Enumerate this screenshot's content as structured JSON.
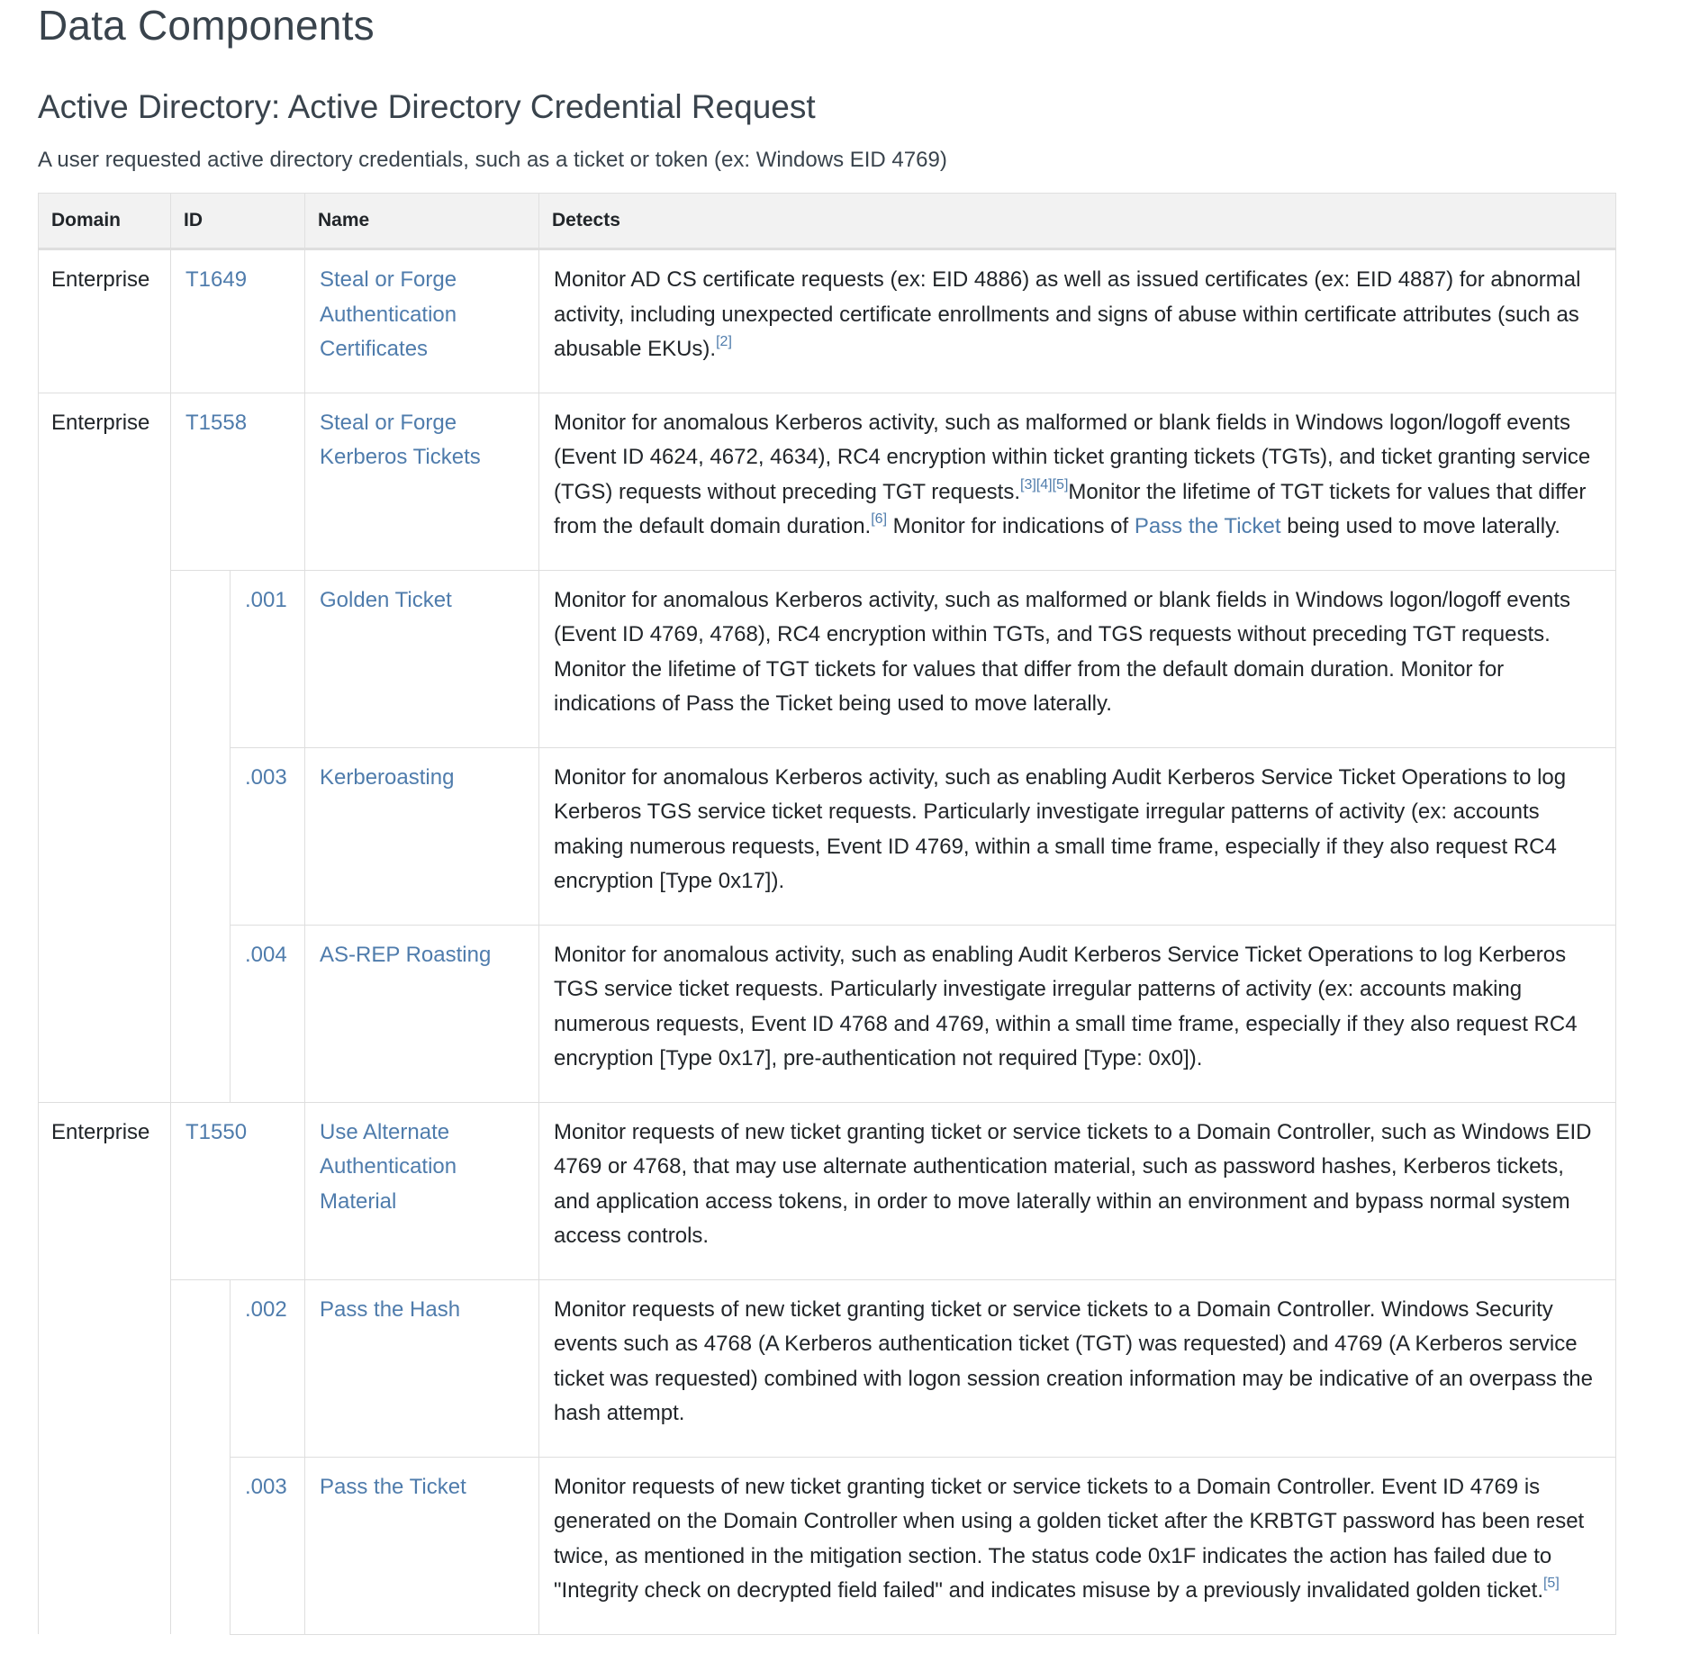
{
  "page": {
    "title": "Data Components",
    "section_title": "Active Directory: Active Directory Credential Request",
    "description": "A user requested active directory credentials, such as a ticket or token (ex: Windows EID 4769)"
  },
  "table": {
    "headers": {
      "domain": "Domain",
      "id": "ID",
      "name": "Name",
      "detects": "Detects"
    },
    "rows": [
      {
        "type": "technique",
        "domain": "Enterprise",
        "id": "T1649",
        "name": "Steal or Forge Authentication Certificates",
        "detects": [
          {
            "text": "Monitor AD CS certificate requests (ex: EID 4886) as well as issued certificates (ex: EID 4887) for abnormal activity, including unexpected certificate enrollments and signs of abuse within certificate attributes (such as abusable EKUs)."
          },
          {
            "ref": "[2]"
          }
        ]
      },
      {
        "type": "technique",
        "domain": "Enterprise",
        "id": "T1558",
        "name": "Steal or Forge Kerberos Tickets",
        "detects": [
          {
            "text": "Monitor for anomalous Kerberos activity, such as malformed or blank fields in Windows logon/logoff events (Event ID 4624, 4672, 4634), RC4 encryption within ticket granting tickets (TGTs), and ticket granting service (TGS) requests without preceding TGT requests."
          },
          {
            "ref": "[3]"
          },
          {
            "ref": "[4]"
          },
          {
            "ref": "[5]"
          },
          {
            "text": "Monitor the lifetime of TGT tickets for values that differ from the default domain duration."
          },
          {
            "ref": "[6]"
          },
          {
            "text": " Monitor for indications of "
          },
          {
            "link": "Pass the Ticket"
          },
          {
            "text": " being used to move laterally."
          }
        ]
      },
      {
        "type": "sub",
        "sub_id": ".001",
        "name": "Golden Ticket",
        "detects": [
          {
            "text": "Monitor for anomalous Kerberos activity, such as malformed or blank fields in Windows logon/logoff events (Event ID 4769, 4768), RC4 encryption within TGTs, and TGS requests without preceding TGT requests. Monitor the lifetime of TGT tickets for values that differ from the default domain duration. Monitor for indications of Pass the Ticket being used to move laterally."
          }
        ]
      },
      {
        "type": "sub",
        "sub_id": ".003",
        "name": "Kerberoasting",
        "detects": [
          {
            "text": "Monitor for anomalous Kerberos activity, such as enabling Audit Kerberos Service Ticket Operations to log Kerberos TGS service ticket requests. Particularly investigate irregular patterns of activity (ex: accounts making numerous requests, Event ID 4769, within a small time frame, especially if they also request RC4 encryption [Type 0x17])."
          }
        ]
      },
      {
        "type": "sub",
        "sub_id": ".004",
        "name": "AS-REP Roasting",
        "detects": [
          {
            "text": "Monitor for anomalous activity, such as enabling Audit Kerberos Service Ticket Operations to log Kerberos TGS service ticket requests. Particularly investigate irregular patterns of activity (ex: accounts making numerous requests, Event ID 4768 and 4769, within a small time frame, especially if they also request RC4 encryption [Type 0x17], pre-authentication not required [Type: 0x0])."
          }
        ]
      },
      {
        "type": "technique",
        "domain": "Enterprise",
        "id": "T1550",
        "name": "Use Alternate Authentication Material",
        "detects": [
          {
            "text": "Monitor requests of new ticket granting ticket or service tickets to a Domain Controller, such as Windows EID 4769 or 4768, that may use alternate authentication material, such as password hashes, Kerberos tickets, and application access tokens, in order to move laterally within an environment and bypass normal system access controls."
          }
        ]
      },
      {
        "type": "sub",
        "sub_id": ".002",
        "name": "Pass the Hash",
        "detects": [
          {
            "text": "Monitor requests of new ticket granting ticket or service tickets to a Domain Controller. Windows Security events such as 4768 (A Kerberos authentication ticket (TGT) was requested) and 4769 (A Kerberos service ticket was requested) combined with logon session creation information may be indicative of an overpass the hash attempt."
          }
        ]
      },
      {
        "type": "sub",
        "sub_id": ".003",
        "name": "Pass the Ticket",
        "detects": [
          {
            "text": "Monitor requests of new ticket granting ticket or service tickets to a Domain Controller. Event ID 4769 is generated on the Domain Controller when using a golden ticket after the KRBTGT password has been reset twice, as mentioned in the mitigation section. The status code 0x1F indicates the action has failed due to \"Integrity check on decrypted field failed\" and indicates misuse by a previously invalidated golden ticket."
          },
          {
            "ref": "[5]"
          }
        ]
      }
    ]
  },
  "colors": {
    "link": "#4f7cac",
    "heading": "#39434c",
    "body_text": "#212529",
    "header_bg": "#f2f2f2",
    "border": "#dedede"
  }
}
